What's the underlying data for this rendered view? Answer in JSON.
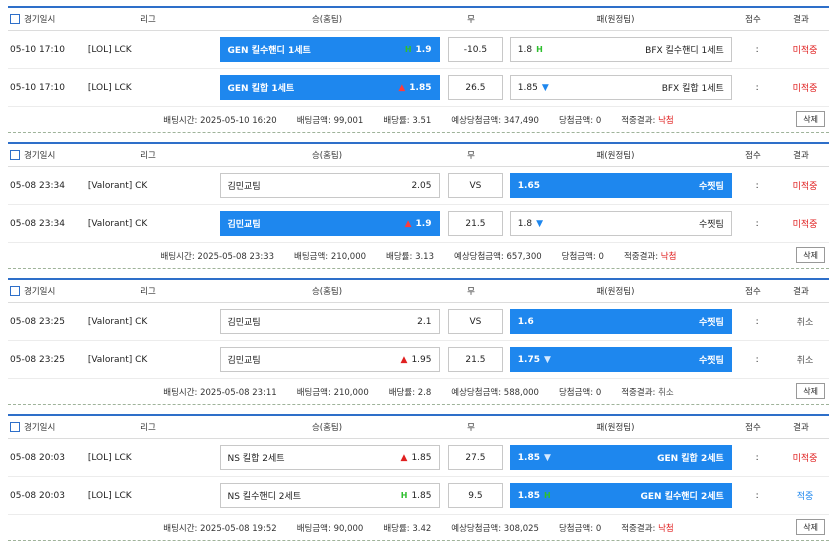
{
  "headers": {
    "date": "경기일시",
    "league": "리그",
    "home": "승(홈팀)",
    "draw": "무",
    "away": "패(원정팀)",
    "score": "점수",
    "result": "결과"
  },
  "delete_label": "삭제",
  "summary_labels": {
    "bet_time": "배팅시간:",
    "bet_amount": "배팅금액:",
    "bet_rate": "배당률:",
    "expected_win": "예상당첨금액:",
    "win_amount": "당첨금액:",
    "bet_result": "적중결과:"
  },
  "blocks": [
    {
      "rows": [
        {
          "date": "05-10 17:10",
          "league": "[LOL] LCK",
          "home_team": "GEN 킬수핸디 1세트",
          "home_odds": "1.9",
          "home_icon": "H",
          "draw": "-10.5",
          "away_odds": "1.8",
          "away_icon": "H",
          "away_team": "BFX 킬수핸디 1세트",
          "score": ":",
          "result": "미적중",
          "sel": "home",
          "result_color": "red"
        },
        {
          "date": "05-10 17:10",
          "league": "[LOL] LCK",
          "home_team": "GEN 킬합 1세트",
          "home_odds": "1.85",
          "home_icon": "▲",
          "draw": "26.5",
          "away_odds": "1.85",
          "away_icon": "▼",
          "away_team": "BFX 킬합 1세트",
          "score": ":",
          "result": "미적중",
          "sel": "home",
          "result_color": "red"
        }
      ],
      "summary": {
        "bet_time": "2025-05-10 16:20",
        "bet_amount": "99,001",
        "bet_rate": "3.51",
        "expected_win": "347,490",
        "win_amount": "0",
        "bet_result": "낙첨",
        "result_color": "red"
      }
    },
    {
      "rows": [
        {
          "date": "05-08 23:34",
          "league": "[Valorant] CK",
          "home_team": "김민교팀",
          "home_odds": "2.05",
          "home_icon": "",
          "draw": "VS",
          "away_odds": "1.65",
          "away_icon": "",
          "away_team": "수찟팀",
          "score": ":",
          "result": "미적중",
          "sel": "away",
          "result_color": "red"
        },
        {
          "date": "05-08 23:34",
          "league": "[Valorant] CK",
          "home_team": "김민교팀",
          "home_odds": "1.9",
          "home_icon": "▲",
          "draw": "21.5",
          "away_odds": "1.8",
          "away_icon": "▼",
          "away_team": "수찟팀",
          "score": ":",
          "result": "미적중",
          "sel": "home",
          "result_color": "red"
        }
      ],
      "summary": {
        "bet_time": "2025-05-08 23:33",
        "bet_amount": "210,000",
        "bet_rate": "3.13",
        "expected_win": "657,300",
        "win_amount": "0",
        "bet_result": "낙첨",
        "result_color": "red"
      }
    },
    {
      "rows": [
        {
          "date": "05-08 23:25",
          "league": "[Valorant] CK",
          "home_team": "김민교팀",
          "home_odds": "2.1",
          "home_icon": "",
          "draw": "VS",
          "away_odds": "1.6",
          "away_icon": "",
          "away_team": "수찟팀",
          "score": ":",
          "result": "취소",
          "sel": "away",
          "result_color": "gray"
        },
        {
          "date": "05-08 23:25",
          "league": "[Valorant] CK",
          "home_team": "김민교팀",
          "home_odds": "1.95",
          "home_icon": "▲",
          "draw": "21.5",
          "away_odds": "1.75",
          "away_icon": "▼",
          "away_team": "수찟팀",
          "score": ":",
          "result": "취소",
          "sel": "away",
          "result_color": "gray"
        }
      ],
      "summary": {
        "bet_time": "2025-05-08 23:11",
        "bet_amount": "210,000",
        "bet_rate": "2.8",
        "expected_win": "588,000",
        "win_amount": "0",
        "bet_result": "취소",
        "result_color": "gray"
      }
    },
    {
      "rows": [
        {
          "date": "05-08 20:03",
          "league": "[LOL] LCK",
          "home_team": "NS 킬합 2세트",
          "home_odds": "1.85",
          "home_icon": "▲",
          "draw": "27.5",
          "away_odds": "1.85",
          "away_icon": "▼",
          "away_team": "GEN 킬합 2세트",
          "score": ":",
          "result": "미적중",
          "sel": "away",
          "result_color": "red"
        },
        {
          "date": "05-08 20:03",
          "league": "[LOL] LCK",
          "home_team": "NS 킬수핸디 2세트",
          "home_odds": "1.85",
          "home_icon": "H",
          "draw": "9.5",
          "away_odds": "1.85",
          "away_icon": "H",
          "away_team": "GEN 킬수핸디 2세트",
          "score": ":",
          "result": "적중",
          "sel": "away",
          "result_color": "blue"
        }
      ],
      "summary": {
        "bet_time": "2025-05-08 19:52",
        "bet_amount": "90,000",
        "bet_rate": "3.42",
        "expected_win": "308,025",
        "win_amount": "0",
        "bet_result": "낙첨",
        "result_color": "red"
      }
    }
  ]
}
